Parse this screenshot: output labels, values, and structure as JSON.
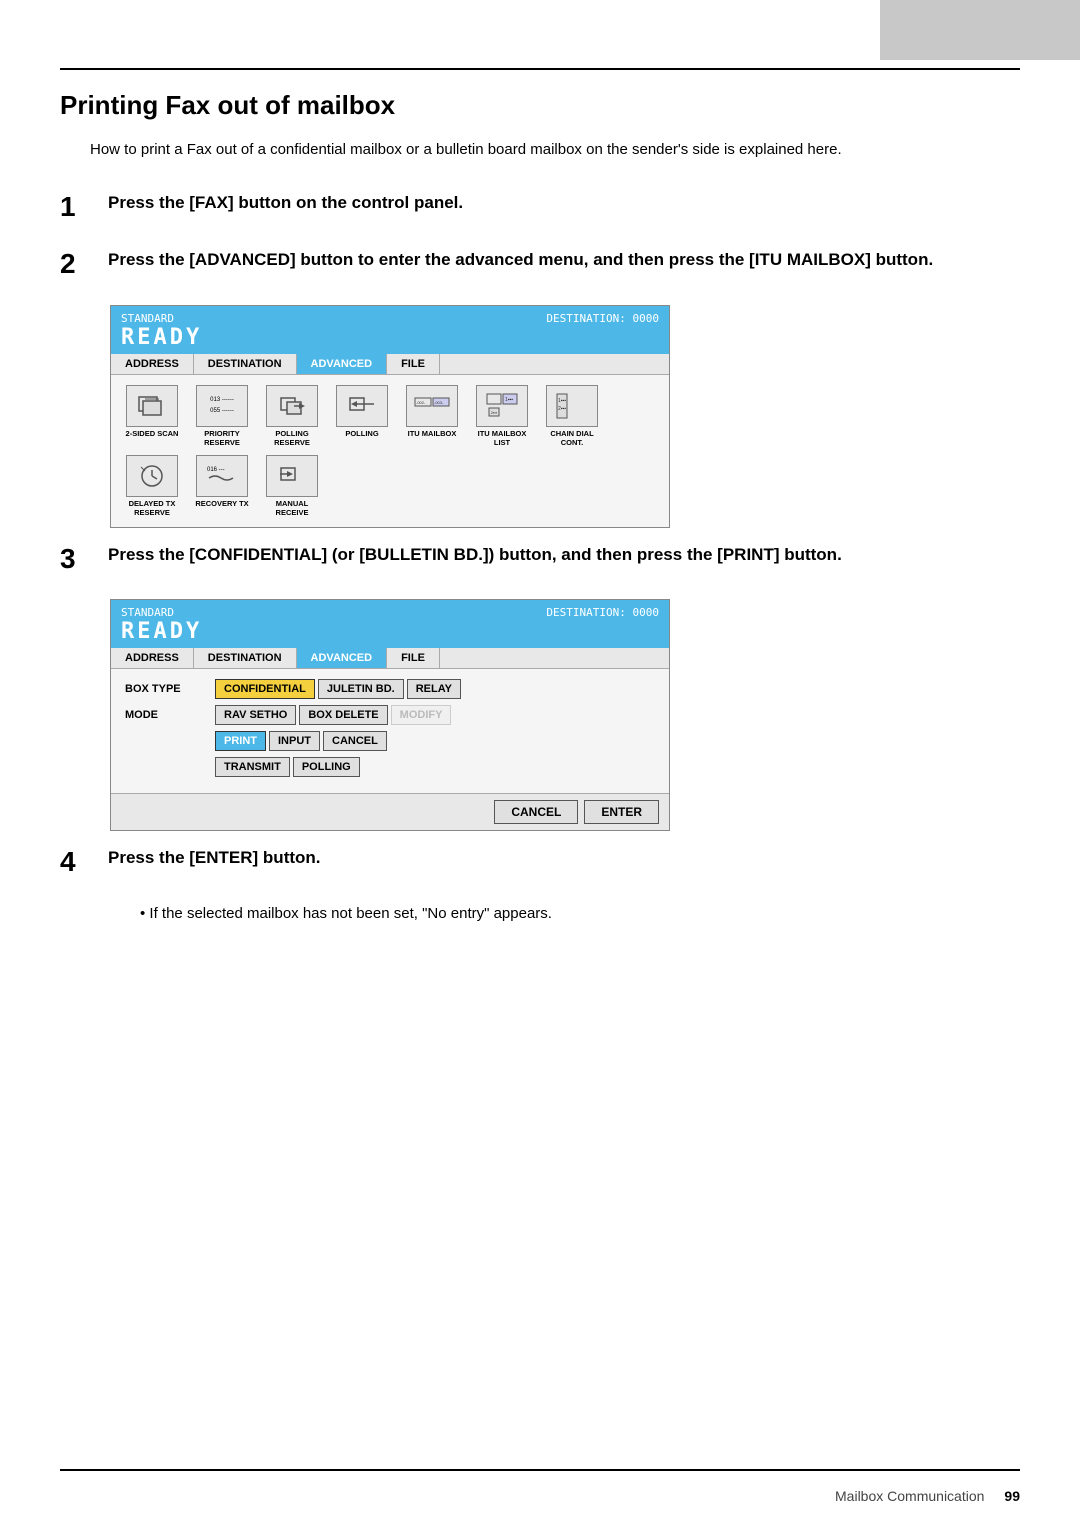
{
  "page": {
    "title": "Printing Fax out of mailbox",
    "intro": "How to print a Fax out of a confidential mailbox or a bulletin board mailbox on the sender's side is explained here.",
    "footer_text": "Mailbox Communication",
    "footer_page": "99"
  },
  "steps": [
    {
      "number": "1",
      "text": "Press the [FAX] button on the control panel."
    },
    {
      "number": "2",
      "text": "Press the [ADVANCED] button to enter the advanced menu, and then press the [ITU MAILBOX] button."
    },
    {
      "number": "3",
      "text": "Press the [CONFIDENTIAL] (or [BULLETIN BD.]) button, and then press the [PRINT] button."
    },
    {
      "number": "4",
      "text": "Press the [ENTER] button.",
      "bullet": "If the selected mailbox has not been set, \"No entry\" appears."
    }
  ],
  "screen1": {
    "header_left": "STANDARD",
    "header_right": "DESTINATION: 0000",
    "ready_text": "READY",
    "tabs": [
      "ADDRESS",
      "DESTINATION",
      "ADVANCED",
      "FILE"
    ],
    "active_tab": "ADVANCED",
    "icon_rows": [
      [
        {
          "label": "2-SIDED SCAN",
          "shape": "scan"
        },
        {
          "label": "PRIORITY RESERVE",
          "shape": "priority",
          "lines": [
            "013 ------",
            "055 ------"
          ]
        },
        {
          "label": "POLLING RESERVE",
          "shape": "polling_res"
        },
        {
          "label": "POLLING",
          "shape": "polling"
        },
        {
          "label": "ITU MAILBOX",
          "shape": "mailbox",
          "lines": [
            "-002-",
            "-003-"
          ]
        },
        {
          "label": "ITU MAILBOX LIST",
          "shape": "mailbox_list"
        },
        {
          "label": "CHAIN DIAL CONT.",
          "shape": "chain"
        }
      ],
      [
        {
          "label": "DELAYED TX RESERVE",
          "shape": "delayed"
        },
        {
          "label": "RECOVERY TX",
          "shape": "recovery",
          "lines": [
            "016 ---"
          ]
        },
        {
          "label": "MANUAL RECEIVE",
          "shape": "manual"
        }
      ]
    ]
  },
  "screen2": {
    "header_left": "STANDARD",
    "header_right": "DESTINATION: 0000",
    "ready_text": "READY",
    "tabs": [
      "ADDRESS",
      "DESTINATION",
      "ADVANCED",
      "FILE"
    ],
    "active_tab": "ADVANCED",
    "rows": [
      {
        "label": "BOX TYPE",
        "buttons": [
          {
            "text": "CONFIDENTIAL",
            "state": "highlighted"
          },
          {
            "text": "JULETIN BD.",
            "state": "normal"
          },
          {
            "text": "RELAY",
            "state": "normal"
          }
        ]
      },
      {
        "label": "MODE",
        "buttons": [
          {
            "text": "RAV SETHO",
            "state": "normal"
          },
          {
            "text": "BOX DELETE",
            "state": "normal"
          },
          {
            "text": "MODIFY",
            "state": "disabled"
          }
        ]
      },
      {
        "label": "",
        "buttons": [
          {
            "text": "PRINT",
            "state": "active"
          },
          {
            "text": "INPUT",
            "state": "normal"
          },
          {
            "text": "CANCEL",
            "state": "normal"
          }
        ]
      },
      {
        "label": "",
        "buttons": [
          {
            "text": "TRANSMIT",
            "state": "normal"
          },
          {
            "text": "POLLING",
            "state": "normal"
          }
        ]
      }
    ],
    "footer_buttons": [
      {
        "text": "CANCEL"
      },
      {
        "text": "ENTER"
      }
    ]
  }
}
